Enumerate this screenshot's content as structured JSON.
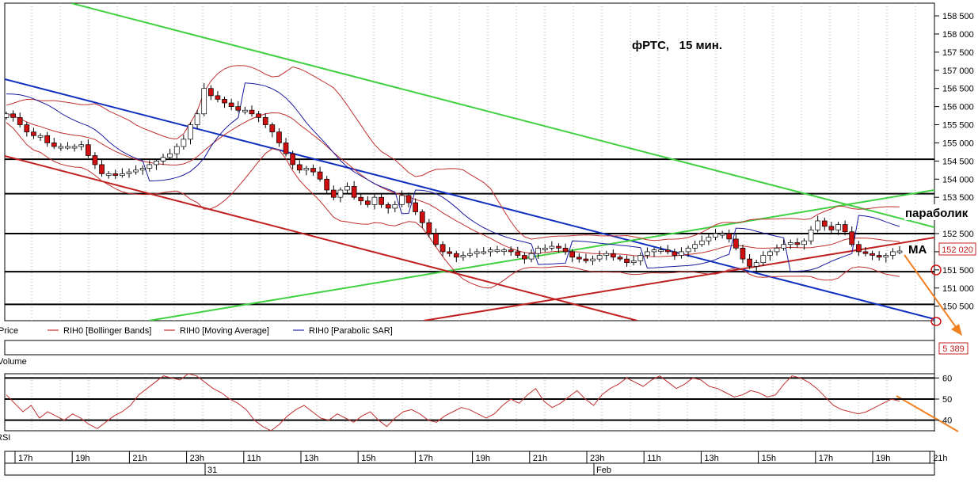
{
  "chart_data": [
    {
      "type": "candlestick",
      "title": "фРТС,   15 мин.",
      "annotations": {
        "parabolic": "параболик",
        "ma": "МА"
      },
      "y_ticks": [
        150500,
        151000,
        151500,
        152000,
        152500,
        153000,
        153500,
        154000,
        154500,
        155000,
        155500,
        156000,
        156500,
        157000,
        157500,
        158000,
        158500
      ],
      "ylim": [
        150100,
        158850
      ],
      "last_price_label": "152 020",
      "legend": [
        {
          "label": "Price",
          "color": "#000000"
        },
        {
          "label": "RIH0 [Bollinger Bands]",
          "color": "#c00000"
        },
        {
          "label": "RIH0 [Moving Average]",
          "color": "#c00000"
        },
        {
          "label": "RIH0 [Parabolic SAR]",
          "color": "#0000a0"
        }
      ],
      "colors": {
        "up": "#ffffff",
        "down": "#d01010",
        "bollinger": "#c03030",
        "ma": "#c03030",
        "sar": "#1a1aa0",
        "trend_blue": "#1030c0",
        "trend_green": "#40d040",
        "trend_red": "#c02020",
        "arrow": "#f08020"
      },
      "horizontal_levels": [
        154550,
        153600,
        152500,
        151450,
        150550
      ],
      "close": [
        155800,
        155700,
        155500,
        155300,
        155200,
        155200,
        155000,
        154900,
        154900,
        154900,
        154900,
        154950,
        154650,
        154400,
        154150,
        154150,
        154100,
        154150,
        154200,
        154250,
        154300,
        154400,
        154500,
        154600,
        154700,
        154900,
        155100,
        155500,
        155800,
        156500,
        156300,
        156200,
        156100,
        156000,
        155900,
        155900,
        155800,
        155700,
        155500,
        155300,
        155000,
        154700,
        154400,
        154250,
        154300,
        154200,
        154000,
        153700,
        153500,
        153700,
        153800,
        153500,
        153400,
        153300,
        153500,
        153300,
        153200,
        153300,
        153550,
        153350,
        153100,
        152800,
        152500,
        152200,
        152000,
        151950,
        151850,
        151900,
        151950,
        152000,
        152000,
        152050,
        152050,
        152050,
        152000,
        151900,
        151800,
        151950,
        152100,
        152100,
        152150,
        152100,
        152000,
        151850,
        151800,
        151750,
        151800,
        151900,
        151950,
        151850,
        151800,
        151700,
        151750,
        151900,
        152000,
        152050,
        152050,
        152000,
        151900,
        152000,
        152100,
        152200,
        152300,
        152400,
        152500,
        152500,
        152350,
        152100,
        151800,
        151600,
        151700,
        151900,
        152000,
        152100,
        152200,
        152250,
        152200,
        152300,
        152600,
        152850,
        152700,
        152600,
        152750,
        152550,
        152200,
        152000,
        151950,
        151900,
        151850,
        151900,
        152000,
        152020
      ],
      "open_note": "open = previous close; first open 155700"
    },
    {
      "type": "bar",
      "label": "Volume",
      "last_value_label": "5 389"
    },
    {
      "type": "line",
      "label": "RSI",
      "y_ticks": [
        40,
        50,
        60
      ],
      "ylim": [
        35,
        62
      ],
      "values": [
        52,
        48,
        44,
        47,
        41,
        44,
        42,
        40,
        43,
        41,
        38,
        36,
        39,
        42,
        44,
        47,
        52,
        55,
        58,
        61,
        60,
        59,
        62,
        61,
        58,
        55,
        53,
        50,
        48,
        45,
        40,
        37,
        35,
        38,
        42,
        45,
        47,
        44,
        41,
        40,
        43,
        41,
        39,
        42,
        44,
        40,
        37,
        41,
        44,
        45,
        43,
        40,
        39,
        42,
        44,
        46,
        45,
        43,
        41,
        43,
        47,
        50,
        48,
        52,
        55,
        49,
        46,
        48,
        51,
        54,
        50,
        47,
        52,
        55,
        57,
        60,
        58,
        56,
        59,
        61,
        58,
        55,
        57,
        60,
        59,
        56,
        55,
        53,
        51,
        52,
        54,
        53,
        51,
        52,
        57,
        61,
        60,
        58,
        55,
        51,
        47,
        45,
        44,
        43,
        44,
        46,
        48,
        50,
        49
      ],
      "arrow_color": "#f08020"
    }
  ],
  "time_axis": {
    "hour_labels": [
      "17h",
      "19h",
      "21h",
      "23h",
      "11h",
      "13h",
      "15h",
      "17h",
      "19h",
      "21h",
      "23h",
      "11h",
      "13h",
      "15h",
      "17h",
      "19h",
      "21h"
    ],
    "day_labels": [
      "31",
      "Feb"
    ]
  }
}
